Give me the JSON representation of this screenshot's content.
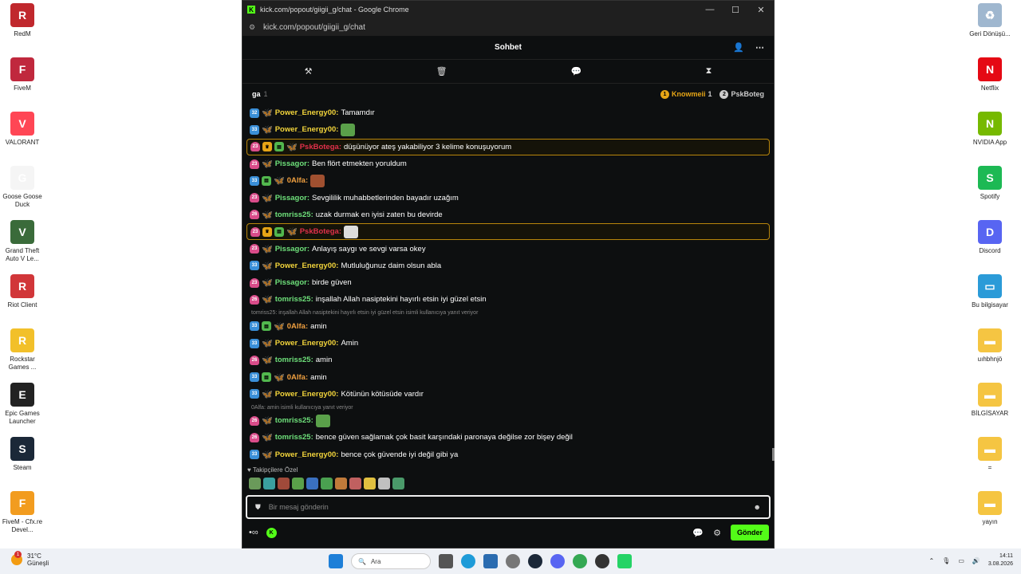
{
  "desktop_left": [
    {
      "label": "RedM",
      "color": "#c0282d",
      "glyph": "R"
    },
    {
      "label": "FiveM",
      "color": "#c0283d",
      "glyph": "F"
    },
    {
      "label": "VALORANT",
      "color": "#ff4655",
      "glyph": "V"
    },
    {
      "label": "Goose Goose Duck",
      "color": "#f5f5f5",
      "glyph": "G"
    },
    {
      "label": "Grand Theft Auto V Le...",
      "color": "#3a6b3a",
      "glyph": "V"
    },
    {
      "label": "Riot Client",
      "color": "#d13639",
      "glyph": "R"
    },
    {
      "label": "Rockstar Games ...",
      "color": "#f2c02a",
      "glyph": "R"
    },
    {
      "label": "Epic Games Launcher",
      "color": "#222222",
      "glyph": "E"
    },
    {
      "label": "Steam",
      "color": "#1b2838",
      "glyph": "S"
    },
    {
      "label": "FiveM - Cfx.re Devel...",
      "color": "#f29c1f",
      "glyph": "F"
    }
  ],
  "desktop_right": [
    {
      "label": "Geri Dönüşü...",
      "color": "#9fb7cf",
      "glyph": "♻"
    },
    {
      "label": "Netflix",
      "color": "#e50914",
      "glyph": "N"
    },
    {
      "label": "NVIDIA App",
      "color": "#76b900",
      "glyph": "N"
    },
    {
      "label": "Spotify",
      "color": "#1db954",
      "glyph": "S"
    },
    {
      "label": "Discord",
      "color": "#5865f2",
      "glyph": "D"
    },
    {
      "label": "Bu bilgisayar",
      "color": "#2b9bd8",
      "glyph": "▭"
    },
    {
      "label": "uıhbhnjö",
      "color": "#f5c542",
      "glyph": "▬"
    },
    {
      "label": "BİLGİSAYAR",
      "color": "#f5c542",
      "glyph": "▬"
    },
    {
      "label": "=",
      "color": "#f5c542",
      "glyph": "▬"
    },
    {
      "label": "yayın",
      "color": "#f5c542",
      "glyph": "▬"
    }
  ],
  "window": {
    "title": "kick.com/popout/giigii_g/chat - Google Chrome",
    "url": "kick.com/popout/giigii_g/chat"
  },
  "chat": {
    "header": "Sohbet",
    "pinned_user": "ga",
    "pinned_count": "1",
    "top1_name": "Knowmeii",
    "top1_count": "1",
    "top1_rank": "1",
    "top2_name": "PskBoteg",
    "top2_rank": "2",
    "messages": [
      {
        "badge": "32",
        "bc": "b-blue",
        "extra": [],
        "fly": "fly-y",
        "user": "Power_Energy00",
        "uc": "c-yellow",
        "text": "Tamamdır",
        "hl": false,
        "emote": ""
      },
      {
        "badge": "33",
        "bc": "b-blue",
        "extra": [],
        "fly": "fly-y",
        "user": "Power_Energy00",
        "uc": "c-yellow",
        "text": "",
        "hl": false,
        "emote": "e-frog"
      },
      {
        "badge": "23",
        "bc": "b-pink",
        "extra": [
          "crown",
          "gift"
        ],
        "fly": "fly-o",
        "user": "PskBotega",
        "uc": "c-red",
        "text": "düşünüyor ateş yakabiliyor 3 kelime konuşuyorum",
        "hl": true,
        "emote": ""
      },
      {
        "badge": "23",
        "bc": "b-pink",
        "extra": [],
        "fly": "fly-o",
        "user": "Pissagor",
        "uc": "c-green",
        "text": "Ben flört etmekten yoruldum",
        "hl": false,
        "emote": ""
      },
      {
        "badge": "33",
        "bc": "b-blue",
        "extra": [
          "gift"
        ],
        "fly": "fly-y",
        "user": "0Alfa",
        "uc": "c-orange",
        "text": "",
        "hl": false,
        "emote": "e-face"
      },
      {
        "badge": "23",
        "bc": "b-pink",
        "extra": [],
        "fly": "fly-o",
        "user": "Pissagor",
        "uc": "c-green",
        "text": "Sevgililik muhabbetlerinden bayadır uzağım",
        "hl": false,
        "emote": ""
      },
      {
        "badge": "26",
        "bc": "b-pink",
        "extra": [],
        "fly": "fly-g",
        "user": "tomriss25",
        "uc": "c-green",
        "text": "uzak durmak en iyisi zaten bu devirde",
        "hl": false,
        "emote": ""
      },
      {
        "badge": "23",
        "bc": "b-pink",
        "extra": [
          "crown",
          "gift"
        ],
        "fly": "fly-o",
        "user": "PskBotega",
        "uc": "c-red",
        "text": "",
        "hl": true,
        "emote": "e-white"
      },
      {
        "badge": "23",
        "bc": "b-pink",
        "extra": [],
        "fly": "fly-o",
        "user": "Pissagor",
        "uc": "c-green",
        "text": "Anlayış saygı ve sevgi varsa okey",
        "hl": false,
        "emote": ""
      },
      {
        "badge": "33",
        "bc": "b-blue",
        "extra": [],
        "fly": "fly-y",
        "user": "Power_Energy00",
        "uc": "c-yellow",
        "text": "Mutluluğunuz daim olsun abla",
        "hl": false,
        "emote": ""
      },
      {
        "badge": "23",
        "bc": "b-pink",
        "extra": [],
        "fly": "fly-o",
        "user": "Pissagor",
        "uc": "c-green",
        "text": "birde güven",
        "hl": false,
        "emote": ""
      },
      {
        "badge": "26",
        "bc": "b-pink",
        "extra": [],
        "fly": "fly-g",
        "user": "tomriss25",
        "uc": "c-green",
        "text": "inşallah Allah nasiptekini hayırlı etsin iyi güzel etsin",
        "hl": false,
        "emote": ""
      },
      {
        "reply": "tomriss25: inşallah Allah nasiptekini hayırlı etsin iyi güzel etsin isimli kullanıcıya yanıt veriyor"
      },
      {
        "badge": "33",
        "bc": "b-blue",
        "extra": [
          "gift"
        ],
        "fly": "fly-y",
        "user": "0Alfa",
        "uc": "c-orange",
        "text": "amin",
        "hl": false,
        "emote": ""
      },
      {
        "badge": "33",
        "bc": "b-blue",
        "extra": [],
        "fly": "fly-y",
        "user": "Power_Energy00",
        "uc": "c-yellow",
        "text": "Amin",
        "hl": false,
        "emote": ""
      },
      {
        "badge": "26",
        "bc": "b-pink",
        "extra": [],
        "fly": "fly-g",
        "user": "tomriss25",
        "uc": "c-green",
        "text": "amin",
        "hl": false,
        "emote": ""
      },
      {
        "badge": "33",
        "bc": "b-blue",
        "extra": [
          "gift"
        ],
        "fly": "fly-y",
        "user": "0Alfa",
        "uc": "c-orange",
        "text": "amin",
        "hl": false,
        "emote": ""
      },
      {
        "badge": "33",
        "bc": "b-blue",
        "extra": [],
        "fly": "fly-y",
        "user": "Power_Energy00",
        "uc": "c-yellow",
        "text": "Kötünün kötüsüde vardır",
        "hl": false,
        "emote": ""
      },
      {
        "reply": "0Alfa: amin isimli kullanıcıya yanıt veriyor"
      },
      {
        "badge": "26",
        "bc": "b-pink",
        "extra": [],
        "fly": "fly-g",
        "user": "tomriss25",
        "uc": "c-green",
        "text": "",
        "hl": false,
        "emote": "e-frog"
      },
      {
        "badge": "26",
        "bc": "b-pink",
        "extra": [],
        "fly": "fly-g",
        "user": "tomriss25",
        "uc": "c-green",
        "text": "bence güven sağlamak çok basit karşındaki paronaya değilse zor bişey değil",
        "hl": false,
        "emote": ""
      },
      {
        "badge": "33",
        "bc": "b-blue",
        "extra": [],
        "fly": "fly-y",
        "user": "Power_Energy00",
        "uc": "c-yellow",
        "text": "bence çok güvende iyi değil gibi ya",
        "hl": false,
        "emote": ""
      }
    ],
    "followers_label": "Takipçilere Özel",
    "emote_colors": [
      "#6a9a5a",
      "#3aa0a0",
      "#a04a3a",
      "#5aa04a",
      "#3a70c0",
      "#4aa050",
      "#c07a3a",
      "#c06060",
      "#e0c040",
      "#c0c0c0",
      "#4a9a6a"
    ],
    "input_placeholder": "Bir mesaj gönderin",
    "send_label": "Gönder"
  },
  "taskbar": {
    "temp": "31°C",
    "weather": "Güneşli",
    "weather_badge": "1",
    "search": "Ara",
    "time": "14:11",
    "date": "3.08.2026"
  }
}
